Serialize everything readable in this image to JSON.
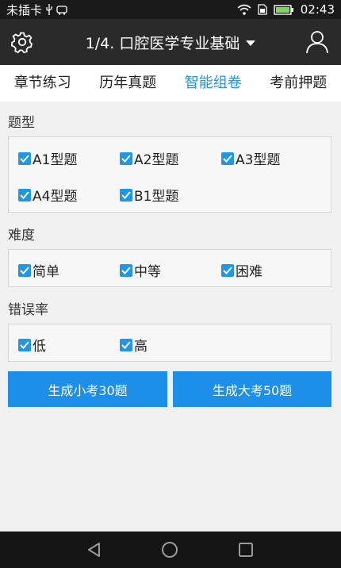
{
  "status_bar": {
    "carrier": "未插卡",
    "time": "02:43"
  },
  "app_bar": {
    "title": "1/4. 口腔医学专业基础"
  },
  "tabs": [
    {
      "label": "章节练习",
      "active": false
    },
    {
      "label": "历年真题",
      "active": false
    },
    {
      "label": "智能组卷",
      "active": true
    },
    {
      "label": "考前押题",
      "active": false
    }
  ],
  "sections": {
    "type": {
      "label": "题型",
      "options": [
        {
          "label": "A1型题",
          "checked": true
        },
        {
          "label": "A2型题",
          "checked": true
        },
        {
          "label": "A3型题",
          "checked": true
        },
        {
          "label": "A4型题",
          "checked": true
        },
        {
          "label": "B1型题",
          "checked": true
        }
      ]
    },
    "difficulty": {
      "label": "难度",
      "options": [
        {
          "label": "简单",
          "checked": true
        },
        {
          "label": "中等",
          "checked": true
        },
        {
          "label": "困难",
          "checked": true
        }
      ]
    },
    "error_rate": {
      "label": "错误率",
      "options": [
        {
          "label": "低",
          "checked": true
        },
        {
          "label": "高",
          "checked": true
        }
      ]
    }
  },
  "buttons": {
    "small_exam": "生成小考30题",
    "big_exam": "生成大考50题"
  },
  "colors": {
    "accent": "#2196e6",
    "button": "#1e8fe8",
    "app_bar": "#2a2a2a"
  }
}
